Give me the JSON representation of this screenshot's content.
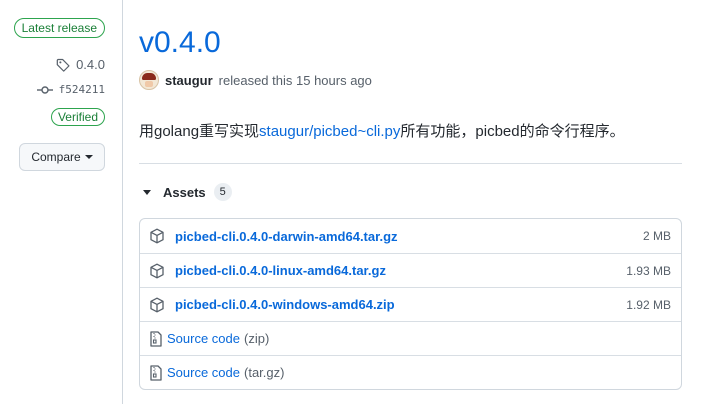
{
  "sidebar": {
    "latest_label": "Latest release",
    "tag": "0.4.0",
    "commit": "f524211",
    "verified_label": "Verified",
    "compare_label": "Compare"
  },
  "release": {
    "title": "v0.4.0",
    "author": "staugur",
    "released_text": "released this 15 hours ago",
    "description_prefix": "用golang重写实现",
    "description_link": "staugur/picbed~cli.py",
    "description_suffix": "所有功能，picbed的命令行程序。"
  },
  "assets": {
    "label": "Assets",
    "count": "5",
    "files": [
      {
        "name": "picbed-cli.0.4.0-darwin-amd64.tar.gz",
        "size": "2 MB"
      },
      {
        "name": "picbed-cli.0.4.0-linux-amd64.tar.gz",
        "size": "1.93 MB"
      },
      {
        "name": "picbed-cli.0.4.0-windows-amd64.zip",
        "size": "1.92 MB"
      }
    ],
    "sources": [
      {
        "label": "Source code",
        "ext": "(zip)"
      },
      {
        "label": "Source code",
        "ext": "(tar.gz)"
      }
    ]
  },
  "colors": {
    "link": "#0969da",
    "success": "#1a7f37",
    "border": "#d0d7de",
    "muted": "#57606a"
  },
  "icons": [
    "tag-icon",
    "git-commit-icon",
    "caret-down-icon",
    "triangle-down-icon",
    "package-icon",
    "file-zip-icon"
  ]
}
